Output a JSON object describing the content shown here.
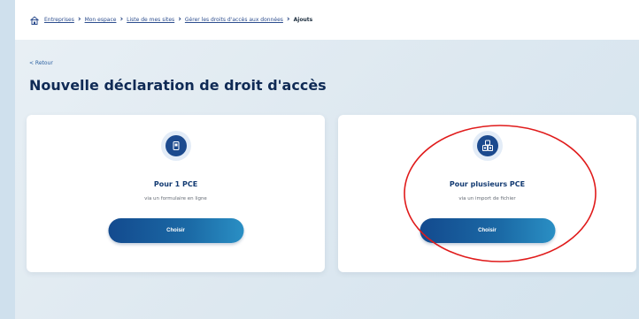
{
  "breadcrumb": {
    "home_icon": "home-icon",
    "items": [
      "Entreprises",
      "Mon espace",
      "Liste de mes sites",
      "Gérer les droits d'accès aux données"
    ],
    "current": "Ajouts"
  },
  "back_label": "< Retour",
  "page_title": "Nouvelle déclaration de droit d'accès",
  "cards": [
    {
      "icon": "document-icon",
      "title": "Pour 1 PCE",
      "subtitle": "via un formulaire en ligne",
      "button": "Choisir"
    },
    {
      "icon": "multiple-documents-icon",
      "title": "Pour plusieurs PCE",
      "subtitle": "via un import de fichier",
      "button": "Choisir"
    }
  ],
  "colors": {
    "brand_dark": "#0f2a55",
    "button_start": "#134a8e",
    "button_end": "#2a8fc4",
    "annotation_red": "#e01b1b"
  }
}
